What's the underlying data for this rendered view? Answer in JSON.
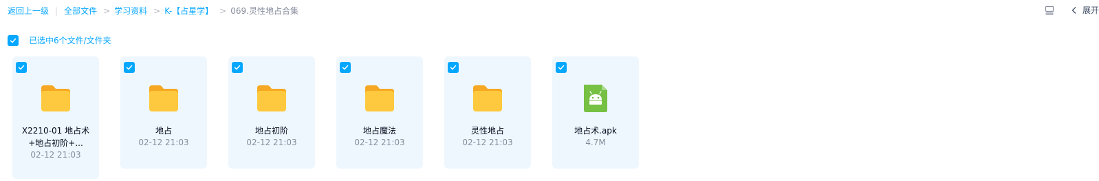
{
  "breadcrumb": {
    "back_label": "返回上一级",
    "divider": "|",
    "items": [
      {
        "label": "全部文件"
      },
      {
        "label": "学习资料"
      },
      {
        "label": "K-【占星学】"
      }
    ],
    "separator": ">",
    "current": "069.灵性地占合集"
  },
  "top_right": {
    "list_icon": "list-view-icon",
    "collapse_icon": "chevron-left-icon",
    "expand_label": "展开"
  },
  "selection": {
    "text": "已选中6个文件/文件夹",
    "checked": true
  },
  "colors": {
    "accent": "#06a7ff",
    "card_bg": "#eef7fe",
    "folder_yellow": "#ffc93f",
    "apk_green": "#76c043"
  },
  "files": [
    {
      "name": "X2210-01 地占术+地占初阶+...",
      "meta": "02-12 21:03",
      "type": "folder",
      "icon": "folder-icon",
      "selected": true
    },
    {
      "name": "地占",
      "meta": "02-12 21:03",
      "type": "folder",
      "icon": "folder-icon",
      "selected": true
    },
    {
      "name": "地占初阶",
      "meta": "02-12 21:03",
      "type": "folder",
      "icon": "folder-icon",
      "selected": true
    },
    {
      "name": "地占魔法",
      "meta": "02-12 21:03",
      "type": "folder",
      "icon": "folder-icon",
      "selected": true
    },
    {
      "name": "灵性地占",
      "meta": "02-12 21:03",
      "type": "folder",
      "icon": "folder-icon",
      "selected": true
    },
    {
      "name": "地占术.apk",
      "meta": "4.7M",
      "type": "apk",
      "icon": "android-apk-icon",
      "selected": true
    }
  ]
}
